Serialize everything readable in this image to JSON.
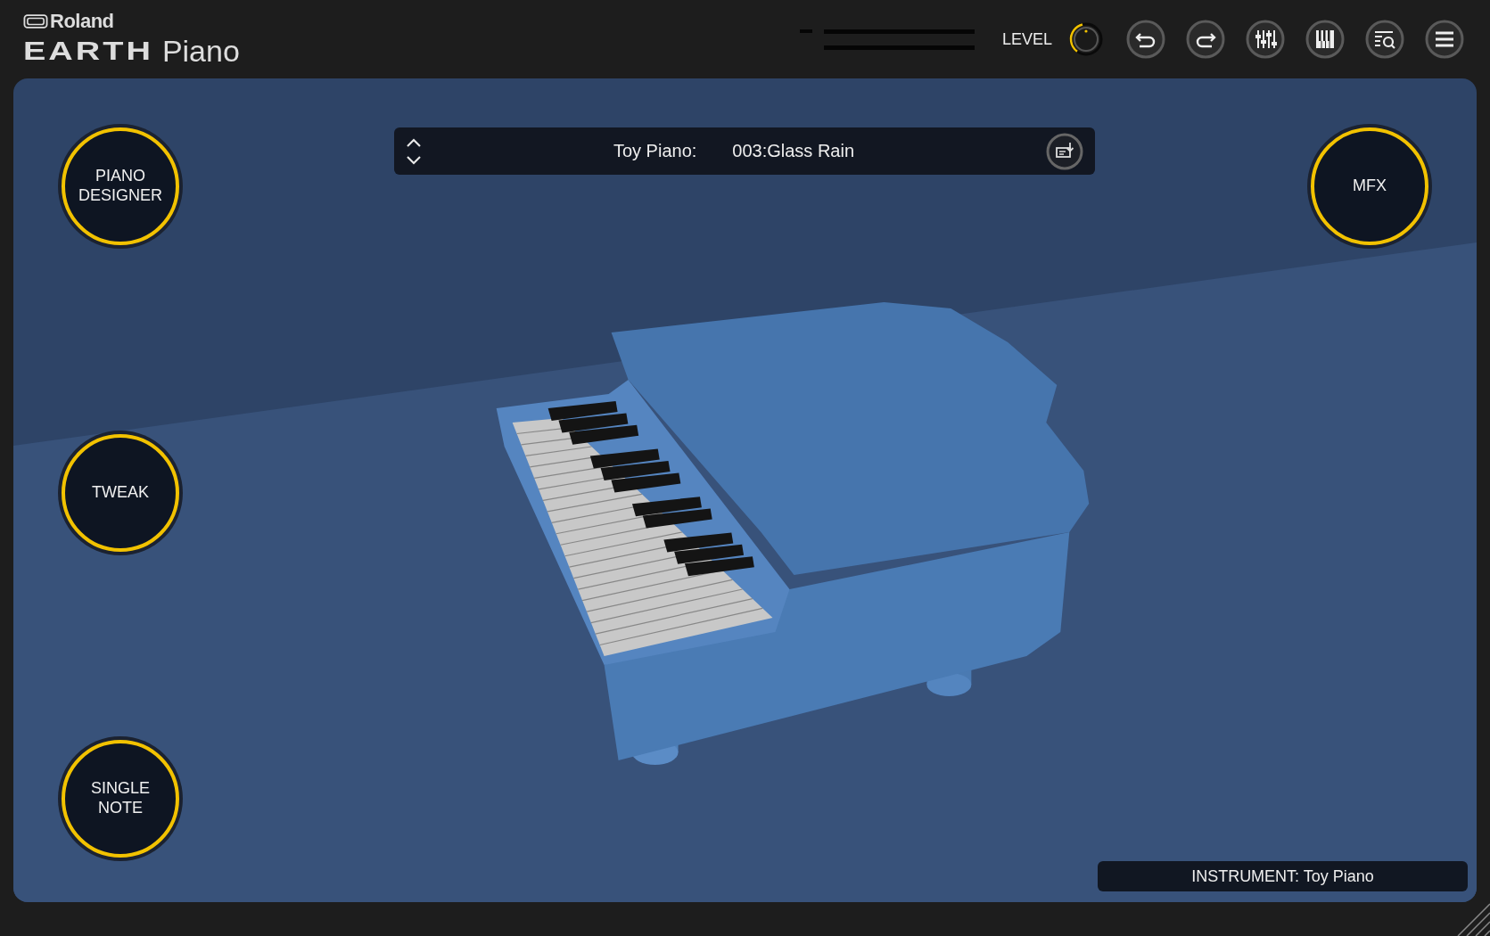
{
  "app": {
    "brand": "Roland",
    "product": "EARTH",
    "product_suffix": "Piano"
  },
  "header": {
    "level_label": "LEVEL",
    "level": 0.45
  },
  "left_buttons": [
    {
      "lines": [
        "PIANO",
        "DESIGNER"
      ]
    },
    {
      "lines": [
        "TWEAK"
      ]
    },
    {
      "lines": [
        "SINGLE",
        "NOTE"
      ]
    }
  ],
  "right_buttons": [
    {
      "lines": [
        "MFX"
      ]
    }
  ],
  "preset": {
    "category": "Toy Piano:",
    "name": "003:Glass Rain"
  },
  "instrument_bar": {
    "text": "INSTRUMENT: Toy Piano"
  }
}
